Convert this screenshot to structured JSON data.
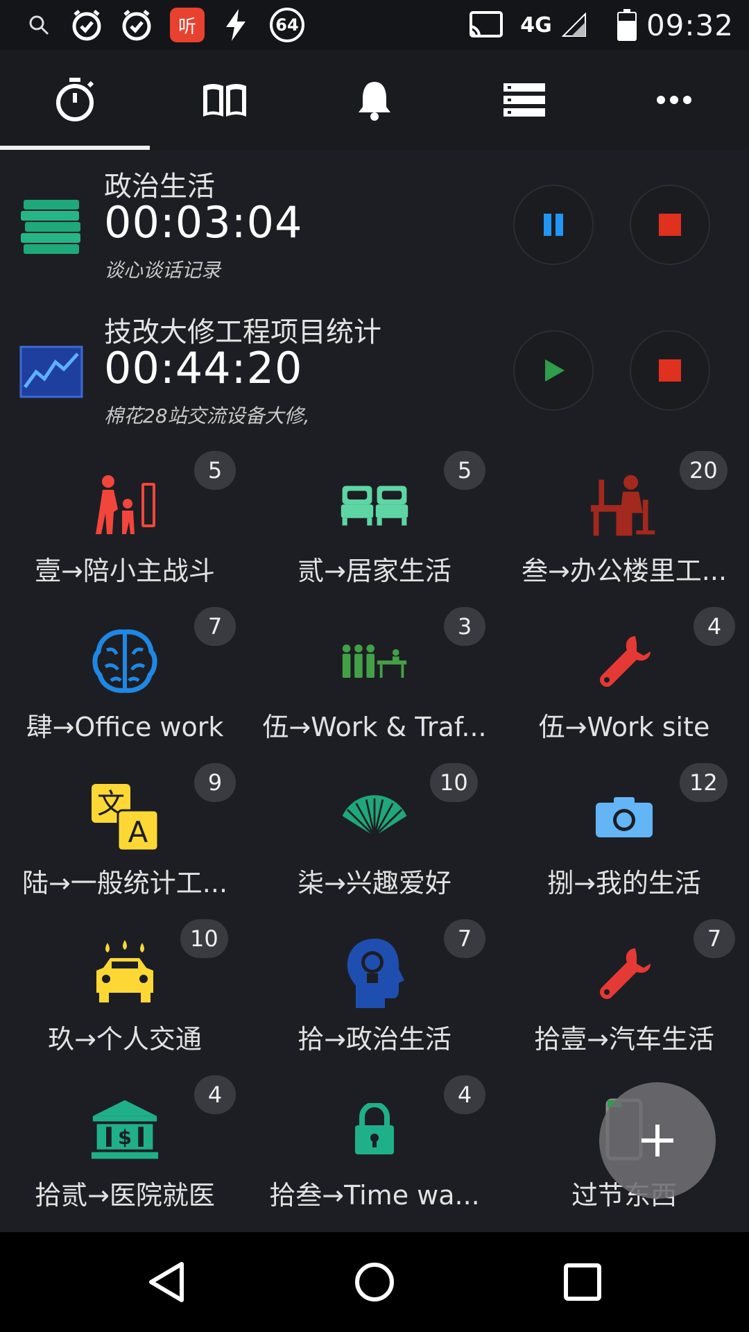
{
  "status_bar": {
    "time": "09:32",
    "network": "4G",
    "notification_badge": "64",
    "app_notice": "听"
  },
  "tabs": [
    {
      "name": "timer",
      "icon": "stopwatch-icon",
      "active": true
    },
    {
      "name": "journal",
      "icon": "book-icon",
      "active": false
    },
    {
      "name": "reminders",
      "icon": "bell-icon",
      "active": false
    },
    {
      "name": "list",
      "icon": "list-icon",
      "active": false
    },
    {
      "name": "more",
      "icon": "more-icon",
      "active": false
    }
  ],
  "active_timers": [
    {
      "title": "政治生活",
      "time": "00:03:04",
      "note": "谈心谈话记录",
      "state": "running",
      "icon": "books-icon"
    },
    {
      "title": "技改大修工程项目统计",
      "time": "00:44:20",
      "note": "棉花28站交流设备大修,",
      "state": "paused",
      "icon": "chart-icon"
    }
  ],
  "categories": [
    {
      "label": "壹→陪小主战斗",
      "count": "5",
      "icon": "parent-child-icon",
      "color": "#f2463c"
    },
    {
      "label": "贰→居家生活",
      "count": "5",
      "icon": "beds-icon",
      "color": "#5ed6a4"
    },
    {
      "label": "叁→办公楼里工...",
      "count": "20",
      "icon": "office-worker-icon",
      "color": "#a3281e"
    },
    {
      "label": "肆→Office work",
      "count": "7",
      "icon": "brain-icon",
      "color": "#1e88e5"
    },
    {
      "label": "伍→Work & Traf...",
      "count": "3",
      "icon": "team-meeting-icon",
      "color": "#43a047"
    },
    {
      "label": "伍→Work site",
      "count": "4",
      "icon": "wrench-icon",
      "color": "#e53935"
    },
    {
      "label": "陆→一般统计工...",
      "count": "9",
      "icon": "translate-icon",
      "color": "#fdd835"
    },
    {
      "label": "柒→兴趣爱好",
      "count": "10",
      "icon": "fan-icon",
      "color": "#1fa87a"
    },
    {
      "label": "捌→我的生活",
      "count": "12",
      "icon": "camera-icon",
      "color": "#64b5f6"
    },
    {
      "label": "玖→个人交通",
      "count": "10",
      "icon": "car-wash-icon",
      "color": "#fdd835"
    },
    {
      "label": "拾→政治生活",
      "count": "7",
      "icon": "head-idea-icon",
      "color": "#1e4fb0"
    },
    {
      "label": "拾壹→汽车生活",
      "count": "7",
      "icon": "wrench-icon",
      "color": "#e53935"
    },
    {
      "label": "拾贰→医院就医",
      "count": "4",
      "icon": "bank-icon",
      "color": "#1fb08a"
    },
    {
      "label": "拾叁→Time wa...",
      "count": "4",
      "icon": "lock-icon",
      "color": "#1fb08a"
    },
    {
      "label": "过节东西",
      "count": "",
      "icon": "phone-icon",
      "color": "#8a8a8a"
    }
  ],
  "colors": {
    "background": "#1d1e23",
    "pause_blue": "#2196f3",
    "play_green": "#2e9e4a",
    "stop_red": "#e0301e"
  }
}
